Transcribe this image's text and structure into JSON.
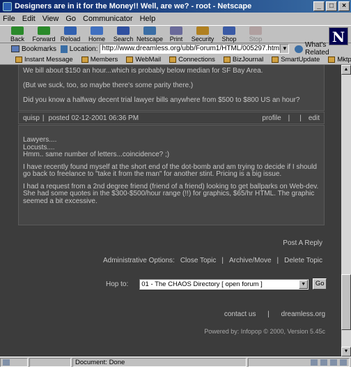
{
  "window": {
    "title": "Designers are in it for the Money!! Well, are we? - root - Netscape"
  },
  "menu": [
    "File",
    "Edit",
    "View",
    "Go",
    "Communicator",
    "Help"
  ],
  "nav": [
    {
      "label": "Back",
      "icon": "back-arrow-icon",
      "color": "#2a8a2a"
    },
    {
      "label": "Forward",
      "icon": "forward-arrow-icon",
      "color": "#2a8a2a"
    },
    {
      "label": "Reload",
      "icon": "reload-icon",
      "color": "#3060b0"
    },
    {
      "label": "Home",
      "icon": "home-icon",
      "color": "#4070c0"
    },
    {
      "label": "Search",
      "icon": "search-icon",
      "color": "#3050a0"
    },
    {
      "label": "Netscape",
      "icon": "netscape-icon",
      "color": "#3a6ea5"
    },
    {
      "label": "Print",
      "icon": "print-icon",
      "color": "#6a6a9a"
    },
    {
      "label": "Security",
      "icon": "lock-icon",
      "color": "#b08020"
    },
    {
      "label": "Shop",
      "icon": "shop-icon",
      "color": "#3a5aa5"
    },
    {
      "label": "Stop",
      "icon": "stop-icon",
      "color": "#b0a0a0"
    }
  ],
  "location": {
    "bookmarks_label": "Bookmarks",
    "location_label": "Location:",
    "url": "http://www.dreamless.org/ubb/Forum1/HTML/005297.html",
    "related_label": "What's Related"
  },
  "personal": [
    "Instant Message",
    "Members",
    "WebMail",
    "Connections",
    "BizJournal",
    "SmartUpdate",
    "Mktplace"
  ],
  "post1": {
    "p1": "We bill about $150 an hour...which is probably below median for SF Bay Area.",
    "p2": "(But we suck, too, so maybe there's some parity there.)",
    "p3": "Did you know a halfway decent trial lawyer bills anywhere from $500 to $800 US an hour?"
  },
  "post2_header": {
    "author": "quisp",
    "sep": "|",
    "posted": "posted 02-12-2001 06:36 PM",
    "profile": "profile",
    "edit": "edit"
  },
  "post2": {
    "l1": "Lawyers....",
    "l2": "Locusts....",
    "l3": "Hmm.. same number of letters...coincidence? ;)",
    "p2": "I have recently found myself at the short end of the dot-bomb and am trying to decide if I should go back to freelance to \"take it from the man\" for another stint. Pricing is a big issue.",
    "p3": "I had a request from a 2nd degree friend (friend of a friend) looking to get ballparks on Web-dev. She had some quotes in the $300-$500/hour range (!!) for graphics, $65/hr HTML. The graphic seemed a bit excessive."
  },
  "post_reply": "Post A Reply",
  "admin": {
    "label": "Administrative Options:",
    "close": "Close Topic",
    "archive": "Archive/Move",
    "delete": "Delete Topic",
    "sep": "|"
  },
  "hop": {
    "label": "Hop to:",
    "selected": "01 - The CHAOS Directory [ open forum ]",
    "go": "Go"
  },
  "footer": {
    "contact": "contact us",
    "sep": "|",
    "site": "dreamless.org",
    "powered": "Powered by: Infopop © 2000, Version 5.45c"
  },
  "status": {
    "text": "Document: Done"
  }
}
